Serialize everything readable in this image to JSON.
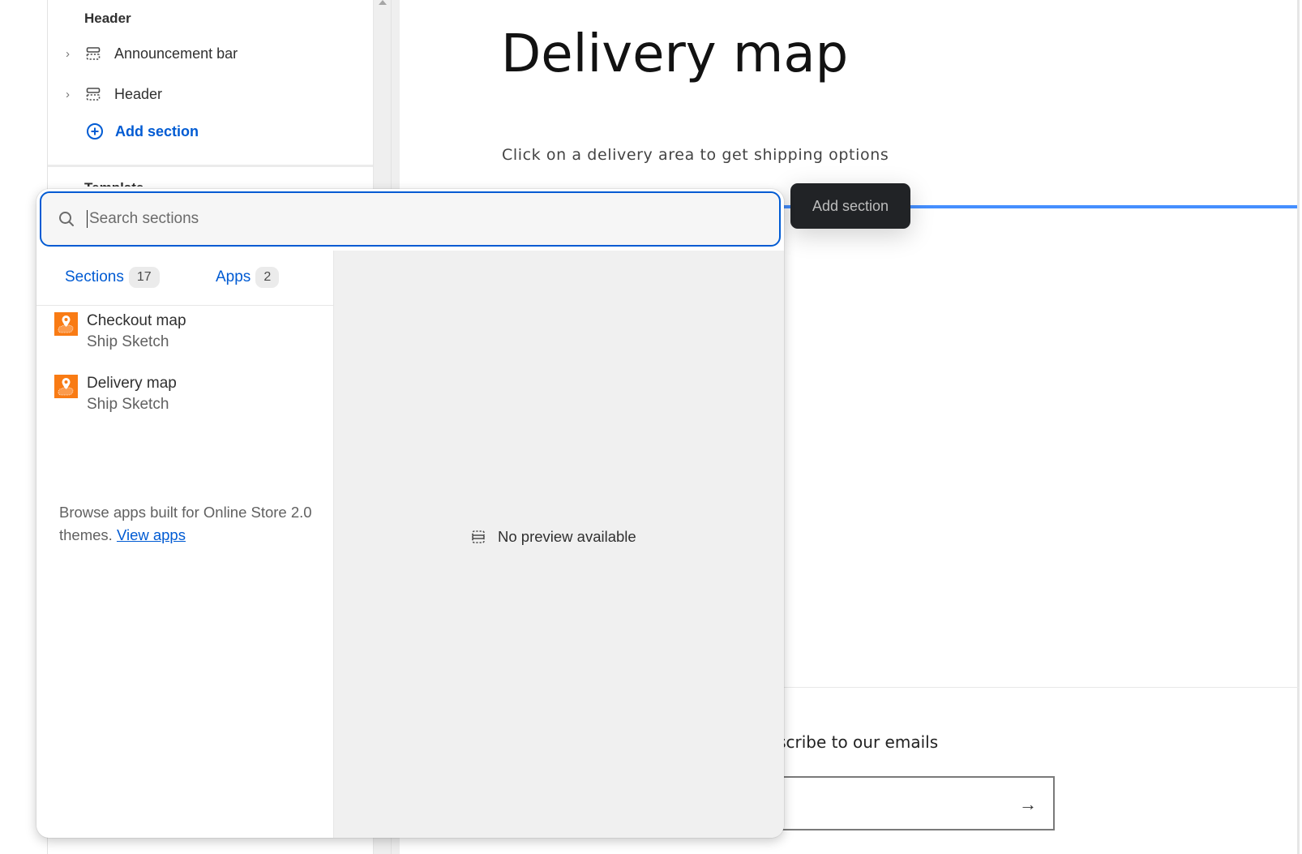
{
  "sidebar": {
    "group_title": "Header",
    "items": [
      {
        "label": "Announcement bar",
        "icon": "section-icon"
      },
      {
        "label": "Header",
        "icon": "section-icon"
      }
    ],
    "add_section_label": "Add section",
    "next_group_title": "Template"
  },
  "preview": {
    "title": "Delivery map",
    "subtitle": "Click on a delivery area to get shipping options",
    "newsletter_title": "Subscribe to our emails",
    "newsletter_submit_icon": "arrow-right-icon"
  },
  "tooltip": {
    "label": "Add section"
  },
  "picker": {
    "search": {
      "placeholder": "Search sections",
      "value": ""
    },
    "tabs": [
      {
        "label": "Sections",
        "count": "17"
      },
      {
        "label": "Apps",
        "count": "2"
      }
    ],
    "results": [
      {
        "title": "Checkout map",
        "subtitle": "Ship Sketch",
        "icon": "ship-sketch-app-icon"
      },
      {
        "title": "Delivery map",
        "subtitle": "Ship Sketch",
        "icon": "ship-sketch-app-icon"
      }
    ],
    "browse": {
      "text": "Browse apps built for Online Store 2.0 themes.",
      "link_label": "View apps"
    },
    "preview_empty": "No preview available"
  },
  "colors": {
    "accent": "#005bd3",
    "insert_line": "#458fff",
    "app_icon": "#f97b14",
    "tooltip_bg": "#212326"
  }
}
